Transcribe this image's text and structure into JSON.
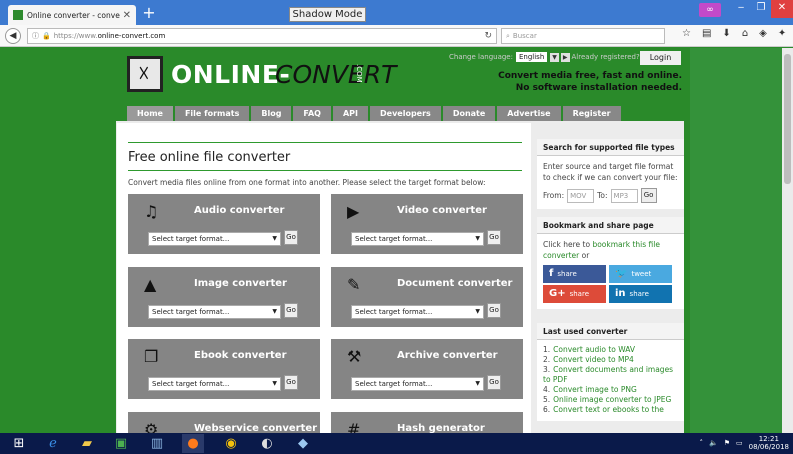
{
  "browser": {
    "tab_title": "Online converter - convert v",
    "tab_close": "✕",
    "new_tab": "+",
    "shadow_mode": "Shadow Mode",
    "url_prefix": "https://www.",
    "url_domain": "online-convert.com",
    "search_placeholder": "Buscar",
    "window_mask": "∞"
  },
  "header": {
    "logo_online": "ONLINE-",
    "logo_convert": "CONVERT",
    "logo_com": ".COM",
    "change_language": "Change language:",
    "language": "English",
    "already_registered": "Already registered?",
    "login": "Login",
    "tagline_1": "Convert media free, fast and online.",
    "tagline_2": "No software installation needed."
  },
  "nav": [
    {
      "label": "Home"
    },
    {
      "label": "File formats"
    },
    {
      "label": "Blog"
    },
    {
      "label": "FAQ"
    },
    {
      "label": "API"
    },
    {
      "label": "Developers"
    },
    {
      "label": "Donate"
    },
    {
      "label": "Advertise"
    },
    {
      "label": "Register"
    }
  ],
  "main": {
    "title": "Free online file converter",
    "intro": "Convert media files online from one format into another. Please select the target format below:",
    "select_placeholder": "Select target format...",
    "go": "Go",
    "converters": [
      {
        "title": "Audio converter",
        "icon": "♫"
      },
      {
        "title": "Video converter",
        "icon": "▶"
      },
      {
        "title": "Image converter",
        "icon": "▲"
      },
      {
        "title": "Document converter",
        "icon": "✎"
      },
      {
        "title": "Ebook converter",
        "icon": "❐"
      },
      {
        "title": "Archive converter",
        "icon": "⚒"
      },
      {
        "title": "Webservice converter",
        "icon": "⚙"
      },
      {
        "title": "Hash generator",
        "icon": "#"
      }
    ]
  },
  "sidebar": {
    "supported_title": "Search for supported file types",
    "supported_text": "Enter source and target file format to check if we can convert your file:",
    "from_label": "From:",
    "from_placeholder": "MOV",
    "to_label": "To:",
    "to_placeholder": "MP3",
    "go": "Go",
    "bookmark_title": "Bookmark and share page",
    "bookmark_pre": "Click here to ",
    "bookmark_link": "bookmark this file converter",
    "bookmark_post": " or",
    "share_fb": "share",
    "share_tw": "tweet",
    "share_gp": "share",
    "share_li": "share",
    "last_title": "Last used converter",
    "last_items": [
      {
        "n": "1.",
        "text": "Convert audio to WAV"
      },
      {
        "n": "2.",
        "text": "Convert video to MP4"
      },
      {
        "n": "3.",
        "text": "Convert documents and images to PDF"
      },
      {
        "n": "4.",
        "text": "Convert image to PNG"
      },
      {
        "n": "5.",
        "text": "Online image converter to JPEG"
      },
      {
        "n": "6.",
        "text": "Convert text or ebooks to the"
      }
    ]
  },
  "taskbar": {
    "time": "12:21",
    "date": "08/06/2018"
  }
}
